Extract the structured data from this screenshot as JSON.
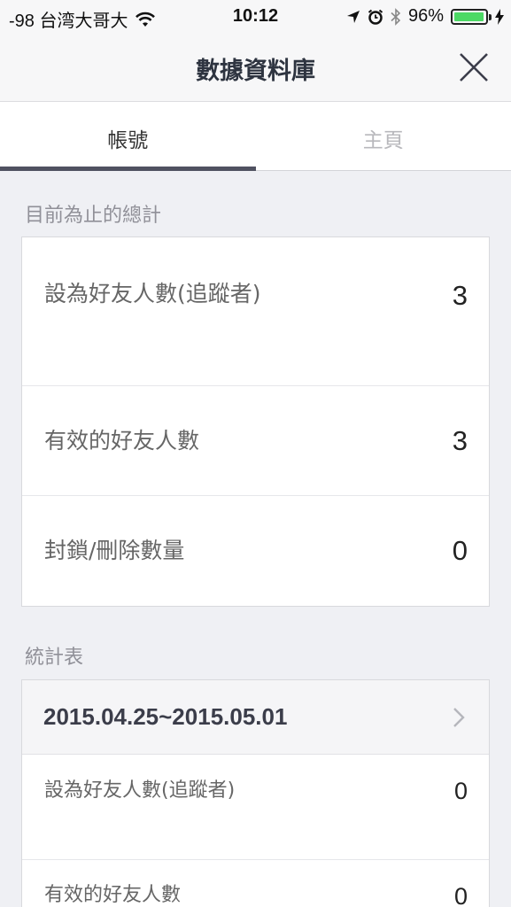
{
  "status_bar": {
    "carrier": "-98 台湾大哥大",
    "time": "10:12",
    "battery": "96%",
    "battery_level": 0.96,
    "icons": [
      "wifi-icon",
      "location-arrow-icon",
      "alarm-icon",
      "bluetooth-icon",
      "battery-icon",
      "charging-bolt-icon"
    ]
  },
  "nav": {
    "title": "數據資料庫",
    "close_icon": "close-icon"
  },
  "tabs": [
    {
      "label": "帳號",
      "active": true
    },
    {
      "label": "主頁",
      "active": false
    }
  ],
  "totals": {
    "section_label": "目前為止的總計",
    "rows": [
      {
        "label": "設為好友人數(追蹤者)",
        "value": "3"
      },
      {
        "label": "有效的好友人數",
        "value": "3"
      },
      {
        "label": "封鎖/刪除數量",
        "value": "0"
      }
    ]
  },
  "stats": {
    "section_label": "統計表",
    "date_range": "2015.04.25~2015.05.01",
    "rows": [
      {
        "label": "設為好友人數(追蹤者)",
        "value": "0"
      },
      {
        "label": "有效的好友人數",
        "value": "0"
      }
    ]
  },
  "colors": {
    "background": "#eff0f4",
    "tab_indicator": "#505261",
    "battery": "#4cd964"
  }
}
